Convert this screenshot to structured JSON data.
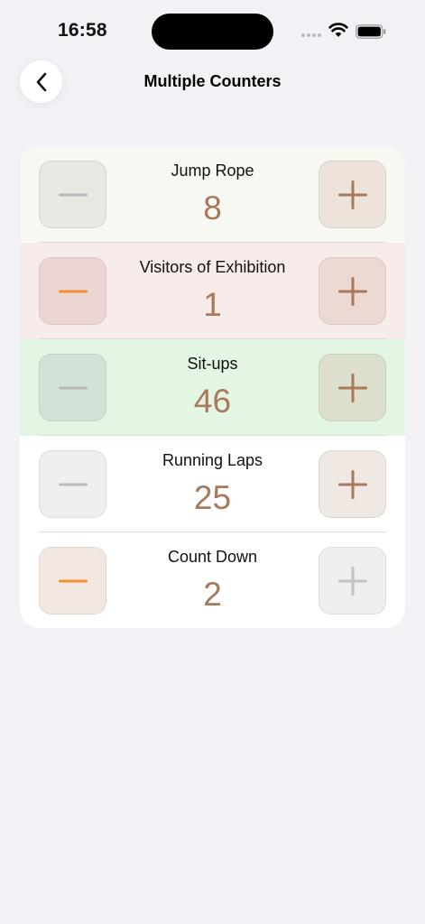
{
  "status": {
    "time": "16:58"
  },
  "nav": {
    "title": "Multiple Counters"
  },
  "counters": [
    {
      "label": "Jump Rope",
      "value": "8",
      "row_bg": "#f8f8f3",
      "minus_bg": "#e8e8e3",
      "minus_color": "#b8b8b8",
      "plus_bg": "#ede3da",
      "plus_color": "#a8795a"
    },
    {
      "label": "Visitors of Exhibition",
      "value": "1",
      "row_bg": "#f8eceb",
      "minus_bg": "#ecd6d3",
      "minus_color": "#f0902e",
      "plus_bg": "#ecd9d4",
      "plus_color": "#a8795a"
    },
    {
      "label": "Sit-ups",
      "value": "46",
      "row_bg": "#e3f6e4",
      "minus_bg": "#d3e2d6",
      "minus_color": "#b8b8b8",
      "plus_bg": "#dcdfcb",
      "plus_color": "#a8795a"
    },
    {
      "label": "Running Laps",
      "value": "25",
      "row_bg": "#ffffff",
      "minus_bg": "#efefef",
      "minus_color": "#bdbdbd",
      "plus_bg": "#f0e8e2",
      "plus_color": "#a8795a"
    },
    {
      "label": "Count Down",
      "value": "2",
      "row_bg": "#ffffff",
      "minus_bg": "#f2e8e1",
      "minus_color": "#f0902e",
      "plus_bg": "#efefef",
      "plus_color": "#c2c2c2"
    }
  ],
  "icons": {
    "back": "chevron-left-icon",
    "minus": "minus-icon",
    "plus": "plus-icon"
  }
}
